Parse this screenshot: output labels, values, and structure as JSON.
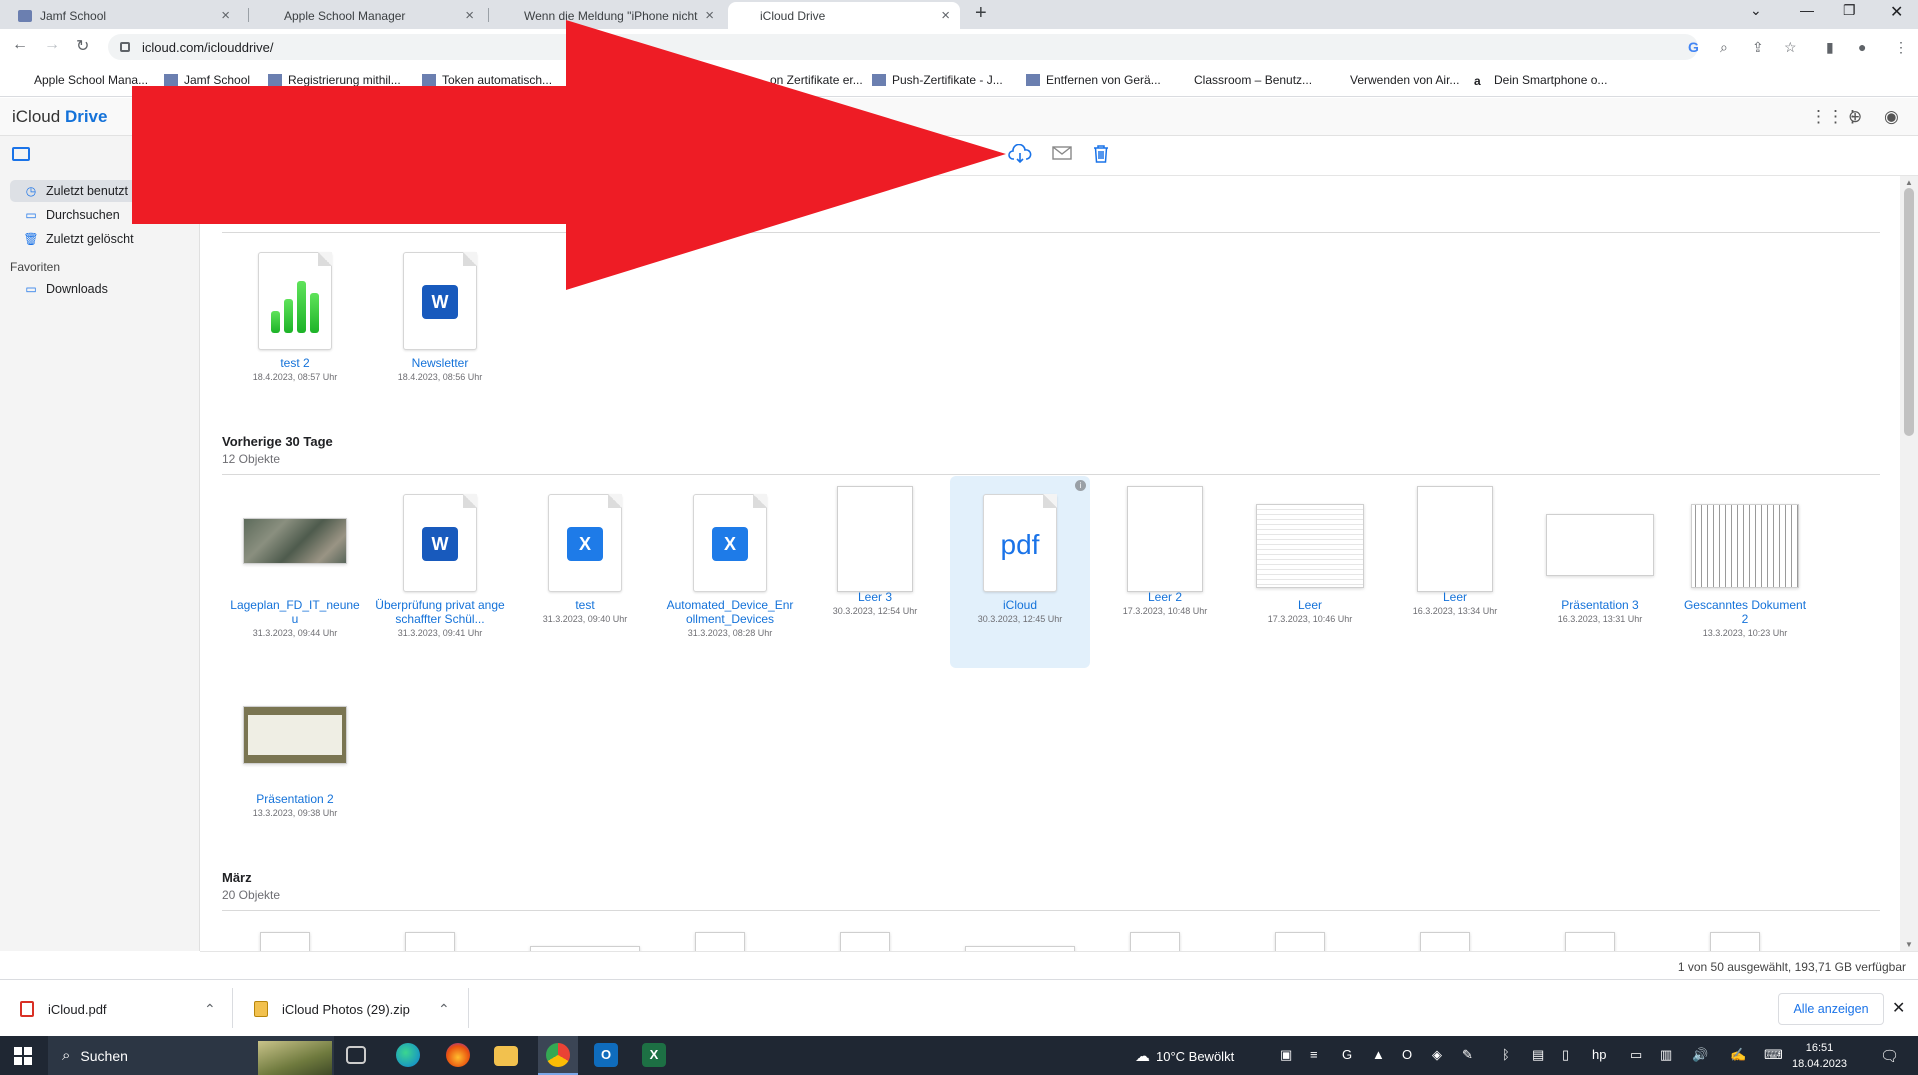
{
  "browser": {
    "tabs": [
      {
        "label": "Jamf School",
        "icon": "jamf-icon",
        "active": false
      },
      {
        "label": "Apple School Manager",
        "icon": "apple-icon",
        "active": false
      },
      {
        "label": "Wenn die Meldung \"iPhone nicht",
        "icon": "apple-icon",
        "active": false
      },
      {
        "label": "iCloud Drive",
        "icon": "apple-icon",
        "active": true
      }
    ],
    "url": "icloud.com/iclouddrive/",
    "bookmarks": [
      "Apple School Mana...",
      "Jamf School",
      "Registrierung mithil...",
      "Token automatisch...",
      "...on Zertifikate er...",
      "Push-Zertifikate - J...",
      "Entfernen von Gerä...",
      "Classroom – Benutz...",
      "Verwenden von Air...",
      "Dein Smartphone o..."
    ]
  },
  "app": {
    "title_prefix": "iCloud",
    "title_suffix": "Drive"
  },
  "sidebar": {
    "items": [
      {
        "label": "Zuletzt benutzt",
        "icon": "clock-icon",
        "selected": true
      },
      {
        "label": "Durchsuchen",
        "icon": "folder-icon",
        "selected": false
      },
      {
        "label": "Zuletzt gelöscht",
        "icon": "trash-icon",
        "selected": false
      }
    ],
    "favorites_heading": "Favoriten",
    "favorites": [
      {
        "label": "Downloads",
        "icon": "folder-icon"
      }
    ]
  },
  "sections": {
    "today": {
      "items": [
        {
          "name": "test 2",
          "date": "18.4.2023, 08:57 Uhr",
          "kind": "numbers"
        },
        {
          "name": "Newsletter",
          "date": "18.4.2023, 08:56 Uhr",
          "kind": "word"
        }
      ]
    },
    "last30": {
      "title": "Vorherige 30 Tage",
      "count": "12 Objekte",
      "items": [
        {
          "name": "Lageplan_FD_IT_neuneu",
          "date": "31.3.2023, 09:44 Uhr",
          "kind": "photo"
        },
        {
          "name": "Überprüfung privat angeschaffter Schül...",
          "date": "31.3.2023, 09:41 Uhr",
          "kind": "word"
        },
        {
          "name": "test",
          "date": "31.3.2023, 09:40 Uhr",
          "kind": "excel"
        },
        {
          "name": "Automated_Device_Enrollment_Devices",
          "date": "31.3.2023, 08:28 Uhr",
          "kind": "excel"
        },
        {
          "name": "Leer 3",
          "date": "30.3.2023, 12:54 Uhr",
          "kind": "page"
        },
        {
          "name": "iCloud",
          "date": "30.3.2023, 12:45 Uhr",
          "kind": "pdf",
          "pdf_label": "pdf"
        },
        {
          "name": "Leer 2",
          "date": "17.3.2023, 10:48 Uhr",
          "kind": "page"
        },
        {
          "name": "Leer",
          "date": "17.3.2023, 10:46 Uhr",
          "kind": "sheet"
        },
        {
          "name": "Leer",
          "date": "16.3.2023, 13:34 Uhr",
          "kind": "page"
        },
        {
          "name": "Präsentation 3",
          "date": "16.3.2023, 13:31 Uhr",
          "kind": "slide"
        },
        {
          "name": "Gescanntes Dokument 2",
          "date": "13.3.2023, 10:23 Uhr",
          "kind": "scan"
        },
        {
          "name": "Präsentation 2",
          "date": "13.3.2023, 09:38 Uhr",
          "kind": "slide2"
        }
      ]
    },
    "march": {
      "title": "März",
      "count": "20 Objekte"
    }
  },
  "status": "1 von 50 ausgewählt, 193,71 GB verfügbar",
  "downloads": {
    "items": [
      {
        "name": "iCloud.pdf",
        "icon": "pdf-file-icon"
      },
      {
        "name": "iCloud Photos (29).zip",
        "icon": "zip-file-icon"
      }
    ],
    "show_all": "Alle anzeigen"
  },
  "taskbar": {
    "search": "Suchen",
    "weather": "10°C  Bewölkt",
    "time": "16:51",
    "date": "18.04.2023"
  },
  "colors": {
    "accent": "#1472d9",
    "arrow": "#ee1c25",
    "selection": "#e2f0fb"
  }
}
